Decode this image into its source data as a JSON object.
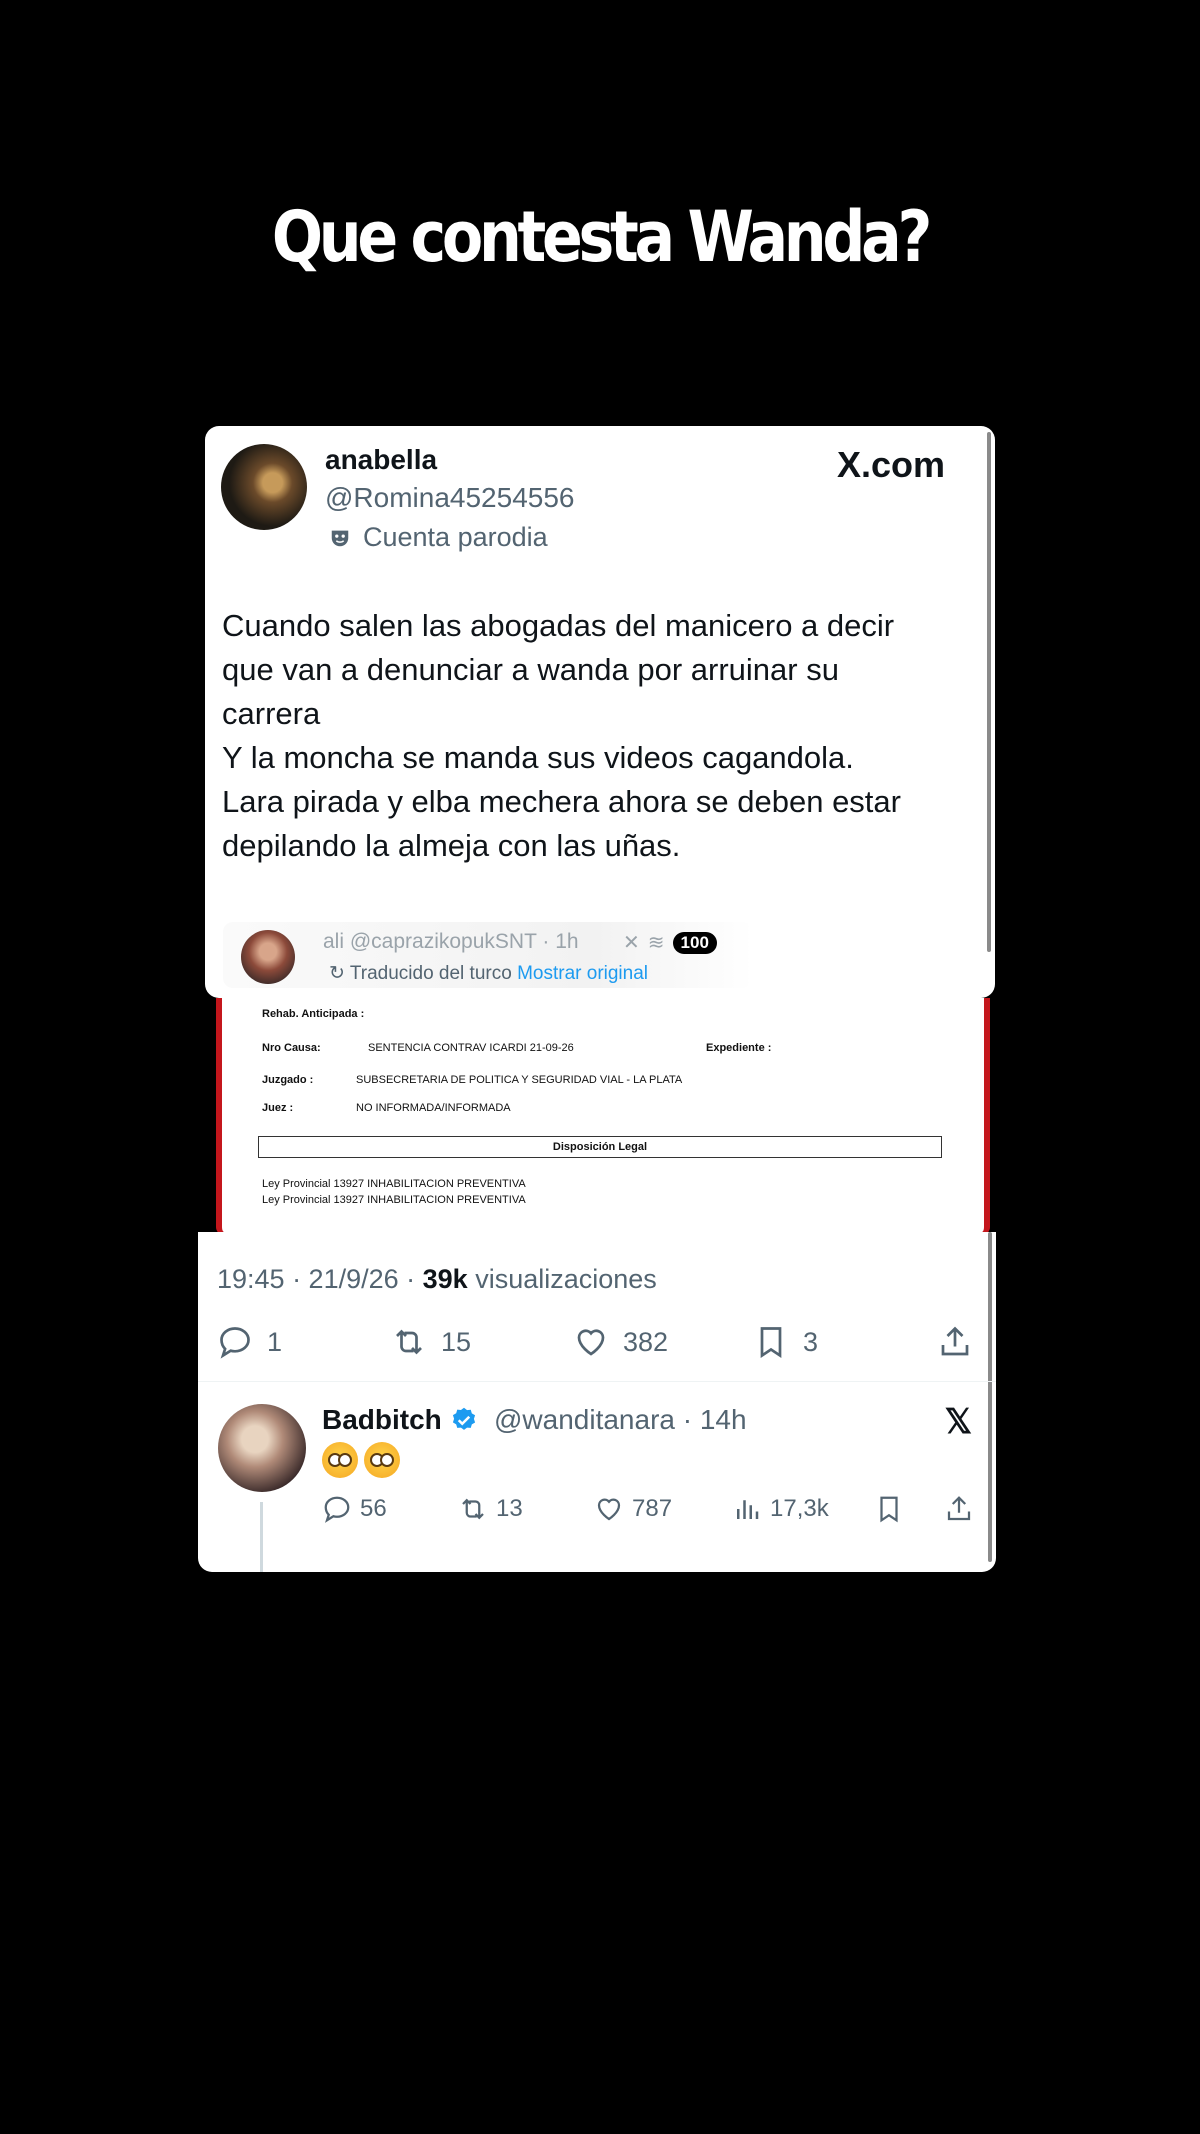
{
  "headline": "Que contesta Wanda?",
  "tweet": {
    "display_name": "anabella",
    "handle": "@Romina45254556",
    "badge_label": "Cuenta parodia",
    "brand": "X.com",
    "text": "Cuando salen las abogadas del manicero a decir\nque van a denunciar a wanda por arruinar su\ncarrera\nY la moncha se manda sus videos cagandola.\nLara pirada y elba mechera ahora se deben estar\ndepilando la almeja con las uñas.",
    "quoted": {
      "name": "ali",
      "handle": "@caprazikopukSNT · 1h",
      "badge": "100",
      "translated": "Traducido del turco",
      "show_original": "Mostrar original"
    },
    "document": {
      "rehab": "Rehab. Anticipada :",
      "causa_label": "Nro Causa:",
      "causa_value": "SENTENCIA CONTRAV ICARDI 21-09-26",
      "expediente_label": "Expediente :",
      "juzgado_label": "Juzgado :",
      "juzgado_value": "SUBSECRETARIA DE POLITICA Y SEGURIDAD VIAL - LA PLATA",
      "juez_label": "Juez :",
      "juez_value": "NO INFORMADA/INFORMADA",
      "legal_header": "Disposición Legal",
      "legal_line1": "Ley Provincial 13927 INHABILITACION PREVENTIVA",
      "legal_line2": "Ley Provincial 13927 INHABILITACION PREVENTIVA"
    },
    "time": "19:45 · 21/9/26 · ",
    "views_count": "39k",
    "views_label": " visualizaciones",
    "replies": "1",
    "retweets": "15",
    "likes": "382",
    "bookmarks": "3"
  },
  "reply": {
    "display_name": "Badbitch",
    "handle": "@wanditanara · 14h",
    "replies": "56",
    "retweets": "13",
    "likes": "787",
    "views": "17,3k"
  }
}
